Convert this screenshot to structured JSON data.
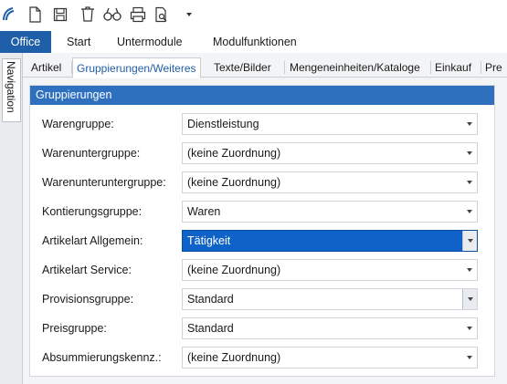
{
  "quick_access": {
    "icons": [
      "app-logo-icon",
      "new-document-icon",
      "save-icon",
      "delete-icon",
      "search-icon",
      "print-icon",
      "print-preview-icon",
      "customize-dropdown-icon"
    ]
  },
  "ribbon": {
    "tabs": [
      "Office",
      "Start",
      "Untermodule",
      "Modulfunktionen"
    ]
  },
  "navigation": {
    "label": "Navigation"
  },
  "content_tabs": {
    "tabs": [
      "Artikel",
      "Gruppierungen/Weiteres",
      "Texte/Bilder",
      "Mengeneinheiten/Kataloge",
      "Einkauf",
      "Pre"
    ],
    "active_index": 1
  },
  "group": {
    "title": "Gruppierungen",
    "rows": [
      {
        "label": "Warengruppe:",
        "value": "Dienstleistung"
      },
      {
        "label": "Warenuntergruppe:",
        "value": "(keine Zuordnung)"
      },
      {
        "label": "Warenunteruntergruppe:",
        "value": "(keine Zuordnung)"
      },
      {
        "label": "Kontierungsgruppe:",
        "value": "Waren"
      },
      {
        "label": "Artikelart Allgemein:",
        "value": "Tätigkeit"
      },
      {
        "label": "Artikelart Service:",
        "value": "(keine Zuordnung)"
      },
      {
        "label": "Provisionsgruppe:",
        "value": "Standard"
      },
      {
        "label": "Preisgruppe:",
        "value": "Standard"
      },
      {
        "label": "Absummierungskennz.:",
        "value": "(keine Zuordnung)"
      }
    ],
    "selected_index": 4
  },
  "colors": {
    "accent": "#1f5ea8",
    "group_header": "#2e6fbe",
    "selection": "#0f62c8"
  }
}
